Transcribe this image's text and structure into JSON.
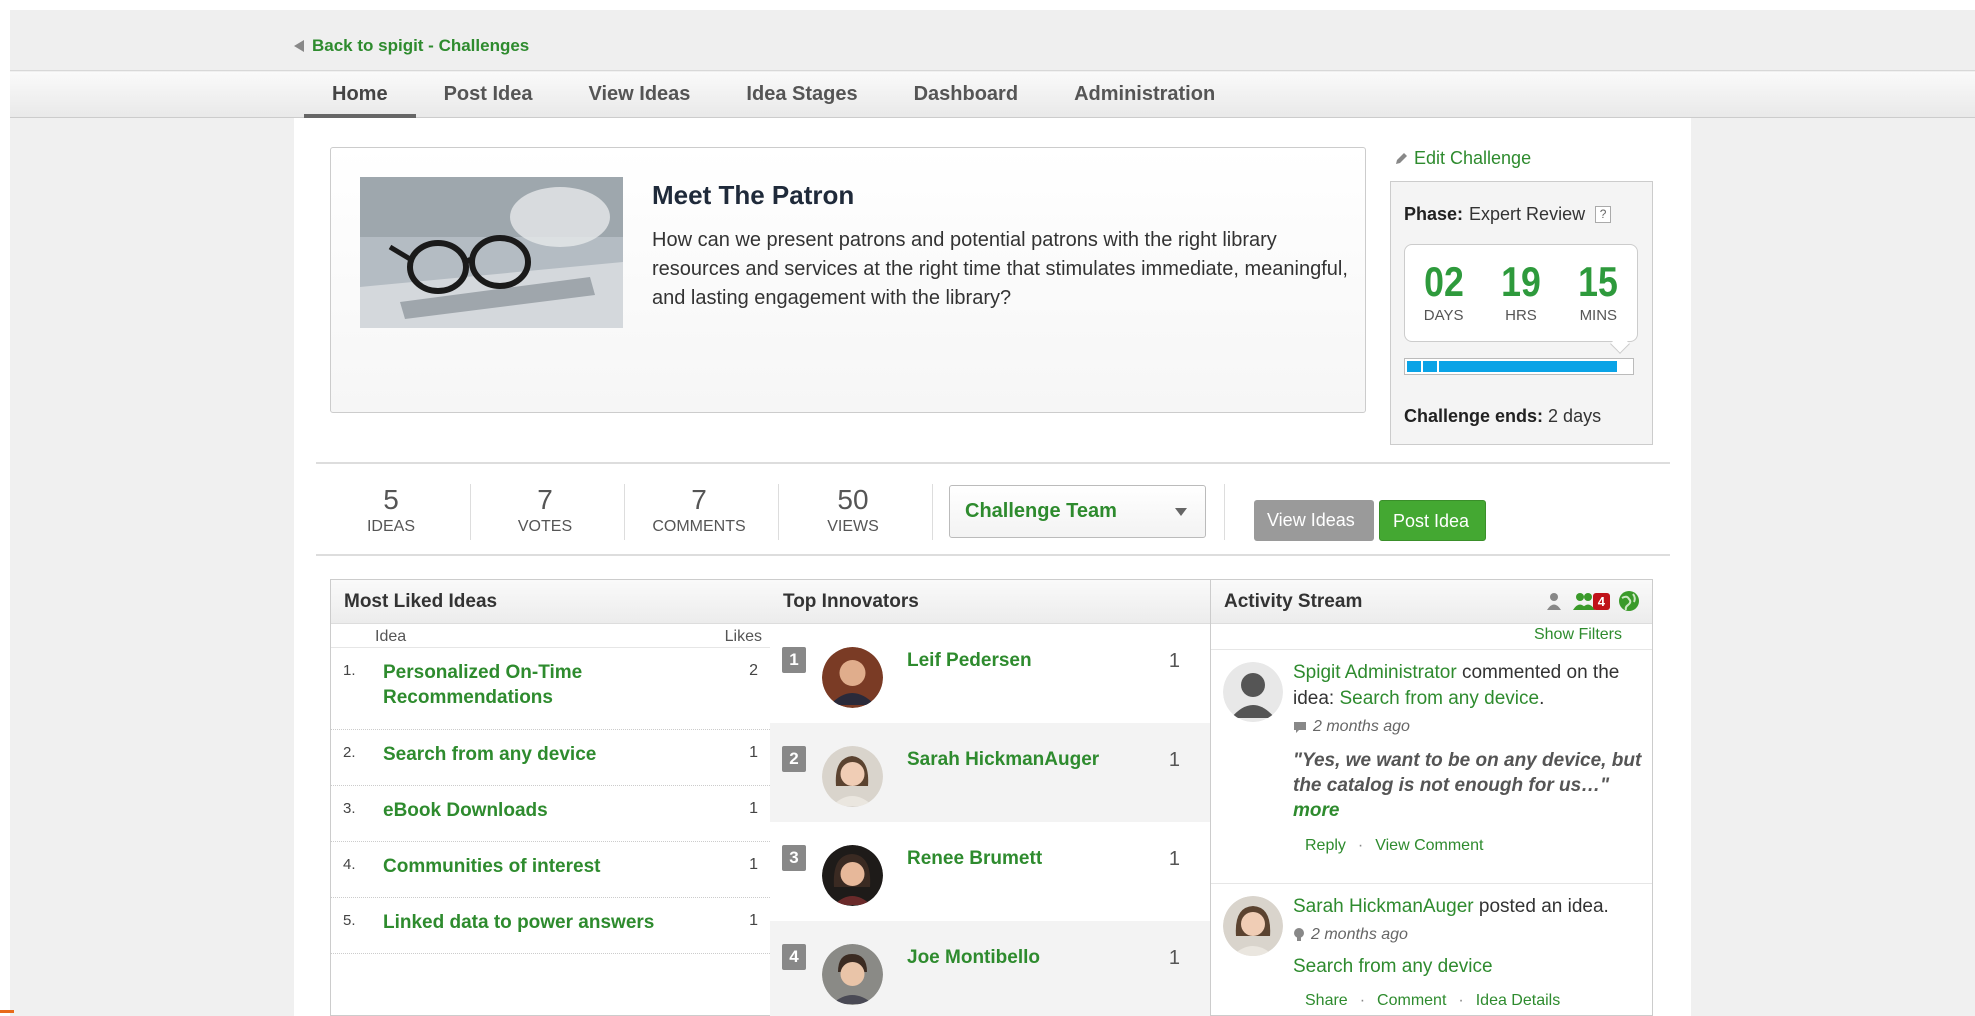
{
  "nav": {
    "back_label": "Back to spigit - Challenges",
    "tabs": [
      "Home",
      "Post Idea",
      "View Ideas",
      "Idea Stages",
      "Dashboard",
      "Administration"
    ]
  },
  "challenge": {
    "title": "Meet The Patron",
    "description": "How can we present patrons and potential patrons with the right library resources and services at the right time that stimulates immediate, meaningful, and lasting engagement with the library?",
    "edit_label": "Edit Challenge",
    "phase_label": "Phase:",
    "phase_value": "Expert Review",
    "help": "?",
    "countdown": {
      "days": "02",
      "days_label": "DAYS",
      "hrs": "19",
      "hrs_label": "HRS",
      "mins": "15",
      "mins_label": "MINS"
    },
    "ends_label": "Challenge ends:",
    "ends_value": "2 days",
    "accent_color": "#2e9a3c",
    "progress_color": "#0aa3e6"
  },
  "stats": [
    {
      "value": "5",
      "label": "IDEAS"
    },
    {
      "value": "7",
      "label": "VOTES"
    },
    {
      "value": "7",
      "label": "COMMENTS"
    },
    {
      "value": "50",
      "label": "VIEWS"
    }
  ],
  "actions": {
    "team_select": "Challenge Team",
    "view_ideas": "View Ideas",
    "post_idea": "Post Idea"
  },
  "most_liked": {
    "title": "Most Liked Ideas",
    "col_idea": "Idea",
    "col_likes": "Likes",
    "rows": [
      {
        "idx": "1.",
        "name": "Personalized On-Time Recommendations",
        "likes": "2"
      },
      {
        "idx": "2.",
        "name": "Search from any device",
        "likes": "1"
      },
      {
        "idx": "3.",
        "name": "eBook Downloads",
        "likes": "1"
      },
      {
        "idx": "4.",
        "name": "Communities of interest",
        "likes": "1"
      },
      {
        "idx": "5.",
        "name": "Linked data to power answers",
        "likes": "1"
      }
    ]
  },
  "top_innovators": {
    "title": "Top Innovators",
    "rows": [
      {
        "rank": "1",
        "name": "Leif Pedersen",
        "score": "1"
      },
      {
        "rank": "2",
        "name": "Sarah HickmanAuger",
        "score": "1"
      },
      {
        "rank": "3",
        "name": "Renee Brumett",
        "score": "1"
      },
      {
        "rank": "4",
        "name": "Joe Montibello",
        "score": "1"
      }
    ]
  },
  "activity": {
    "title": "Activity Stream",
    "badge_count": "4",
    "show_filters": "Show Filters",
    "items": [
      {
        "user": "Spigit Administrator",
        "verb": " commented on the idea: ",
        "target": "Search from any device",
        "tail": ".",
        "time": "2 months ago",
        "quote": "\"Yes, we want to be on any device, but the catalog is not enough for us…\"",
        "more": "more",
        "reply": "Reply",
        "view_comment": "View Comment"
      },
      {
        "user": "Sarah HickmanAuger",
        "verb": " posted an idea.",
        "time": "2 months ago",
        "idea": "Search from any device",
        "share": "Share",
        "comment": "Comment",
        "details": "Idea Details"
      }
    ],
    "separator": "·"
  }
}
